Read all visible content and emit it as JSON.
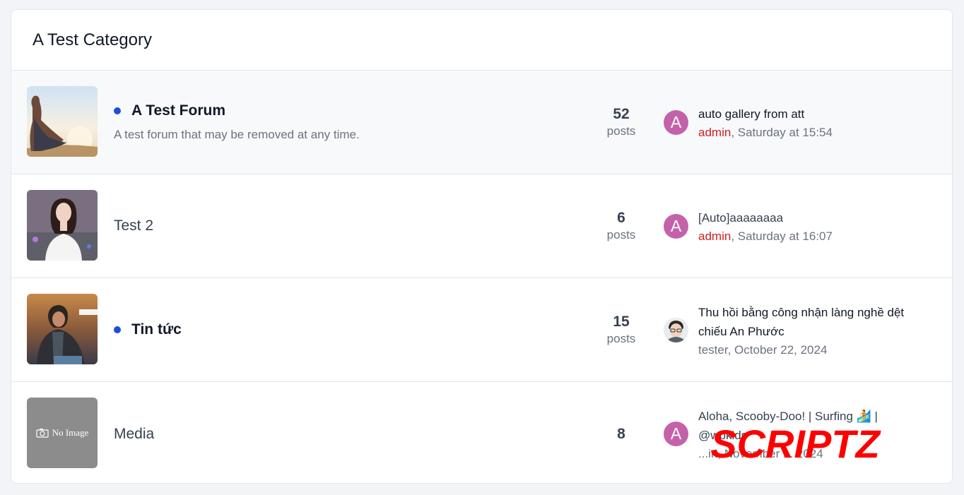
{
  "category": {
    "title": "A Test Category"
  },
  "forums": [
    {
      "title": "A Test Forum",
      "unread": true,
      "description": "A test forum that may be removed at any time.",
      "posts_count": "52",
      "posts_label": "posts",
      "latest": {
        "title": "auto gallery from att",
        "user": "admin",
        "date": ", Saturday at 15:54",
        "avatar_letter": "A"
      }
    },
    {
      "title": "Test 2",
      "unread": false,
      "posts_count": "6",
      "posts_label": "posts",
      "latest": {
        "title": "[Auto]aaaaaaaa",
        "user": "admin",
        "date": ", Saturday at 16:07",
        "avatar_letter": "A"
      }
    },
    {
      "title": "Tin tức",
      "unread": true,
      "posts_count": "15",
      "posts_label": "posts",
      "latest": {
        "title": "Thu hồi bằng công nhận làng nghề dệt chiếu An Phước",
        "user": "tester",
        "date": ", October 22, 2024"
      }
    },
    {
      "title": "Media",
      "unread": false,
      "posts_count": "8",
      "posts_label": "",
      "thumb_text": "No Image",
      "latest": {
        "title": "Aloha, Scooby-Doo! | Surfing 🏄 | @wbkids",
        "user": "",
        "date": "...in, November ... 2024",
        "avatar_letter": "A"
      }
    }
  ],
  "watermark": "SCRIPTZ",
  "colors": {
    "accent": "#1d4ed8",
    "avatar": "#c561a9",
    "user_link": "#d21f1f",
    "watermark": "#ff0000"
  }
}
